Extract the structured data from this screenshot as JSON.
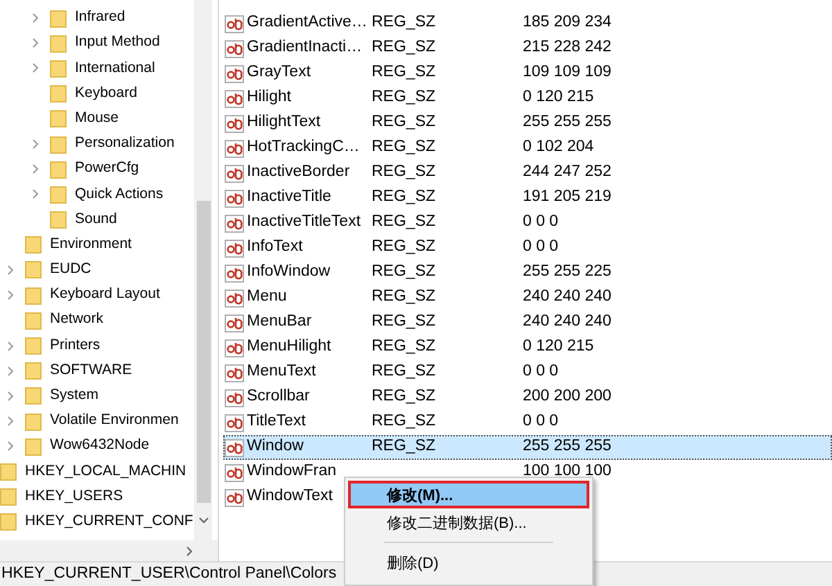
{
  "tree": [
    {
      "children": [
        {
          "children": [
            {
              "label": "Infrared",
              "expandable": true
            },
            {
              "label": "Input Method",
              "expandable": true
            },
            {
              "label": "International",
              "expandable": true
            },
            {
              "label": "Keyboard",
              "expandable": false
            },
            {
              "label": "Mouse",
              "expandable": false
            },
            {
              "label": "Personalization",
              "expandable": true
            },
            {
              "label": "PowerCfg",
              "expandable": true
            },
            {
              "label": "Quick Actions",
              "expandable": true
            },
            {
              "label": "Sound",
              "expandable": false
            }
          ]
        },
        {
          "label": "Environment",
          "expandable": false
        },
        {
          "label": "EUDC",
          "expandable": true
        },
        {
          "label": "Keyboard Layout",
          "expandable": true
        },
        {
          "label": "Network",
          "expandable": false
        },
        {
          "label": "Printers",
          "expandable": true
        },
        {
          "label": "SOFTWARE",
          "expandable": true
        },
        {
          "label": "System",
          "expandable": true
        },
        {
          "label": "Volatile Environmen",
          "expandable": true
        },
        {
          "label": "Wow6432Node",
          "expandable": true
        }
      ]
    },
    {
      "label": "HKEY_LOCAL_MACHIN"
    },
    {
      "label": "HKEY_USERS"
    },
    {
      "label": "HKEY_CURRENT_CONF"
    }
  ],
  "values": [
    {
      "name": "GradientActive…",
      "type": "REG_SZ",
      "data": "185 209 234",
      "selected": false
    },
    {
      "name": "GradientInacti…",
      "type": "REG_SZ",
      "data": "215 228 242",
      "selected": false
    },
    {
      "name": "GrayText",
      "type": "REG_SZ",
      "data": "109 109 109",
      "selected": false
    },
    {
      "name": "Hilight",
      "type": "REG_SZ",
      "data": "0 120 215",
      "selected": false
    },
    {
      "name": "HilightText",
      "type": "REG_SZ",
      "data": "255 255 255",
      "selected": false
    },
    {
      "name": "HotTrackingC…",
      "type": "REG_SZ",
      "data": "0 102 204",
      "selected": false
    },
    {
      "name": "InactiveBorder",
      "type": "REG_SZ",
      "data": "244 247 252",
      "selected": false
    },
    {
      "name": "InactiveTitle",
      "type": "REG_SZ",
      "data": "191 205 219",
      "selected": false
    },
    {
      "name": "InactiveTitleText",
      "type": "REG_SZ",
      "data": "0 0 0",
      "selected": false
    },
    {
      "name": "InfoText",
      "type": "REG_SZ",
      "data": "0 0 0",
      "selected": false
    },
    {
      "name": "InfoWindow",
      "type": "REG_SZ",
      "data": "255 255 225",
      "selected": false
    },
    {
      "name": "Menu",
      "type": "REG_SZ",
      "data": "240 240 240",
      "selected": false
    },
    {
      "name": "MenuBar",
      "type": "REG_SZ",
      "data": "240 240 240",
      "selected": false
    },
    {
      "name": "MenuHilight",
      "type": "REG_SZ",
      "data": "0 120 215",
      "selected": false
    },
    {
      "name": "MenuText",
      "type": "REG_SZ",
      "data": "0 0 0",
      "selected": false
    },
    {
      "name": "Scrollbar",
      "type": "REG_SZ",
      "data": "200 200 200",
      "selected": false
    },
    {
      "name": "TitleText",
      "type": "REG_SZ",
      "data": "0 0 0",
      "selected": false
    },
    {
      "name": "Window",
      "type": "REG_SZ",
      "data": "255 255 255",
      "selected": true
    },
    {
      "name": "WindowFran",
      "data": "100 100 100",
      "selected": false
    },
    {
      "name": "WindowText",
      "selected": false
    }
  ],
  "context_menu": [
    {
      "kind": "item",
      "label": "修改(M)...",
      "highlighted": true,
      "outlined": true
    },
    {
      "kind": "item",
      "label": "修改二进制数据(B)...",
      "highlighted": false,
      "outlined": false
    },
    {
      "kind": "separator"
    },
    {
      "kind": "item",
      "label": "删除(D)",
      "highlighted": false,
      "outlined": false
    }
  ],
  "status_bar": "HKEY_CURRENT_USER\\Control Panel\\Colors"
}
